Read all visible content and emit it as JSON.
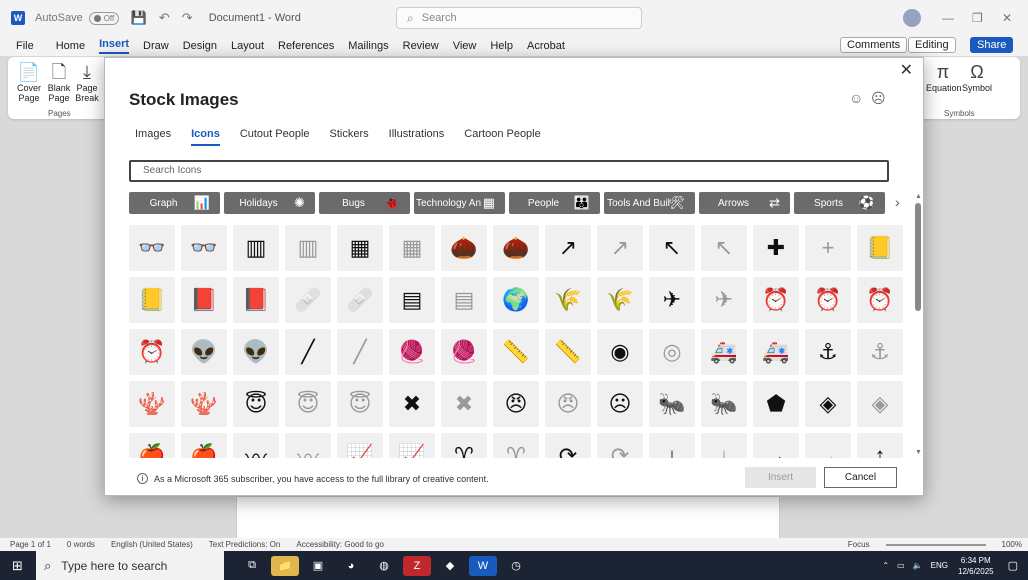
{
  "app": {
    "logo": "W",
    "autosave_label": "AutoSave",
    "autosave_state": "Off",
    "document_title": "Document1 - Word",
    "search_placeholder": "Search",
    "window_controls": [
      "—",
      "❐",
      "✕"
    ]
  },
  "menu": [
    "File",
    "Home",
    "Insert",
    "Draw",
    "Design",
    "Layout",
    "References",
    "Mailings",
    "Review",
    "View",
    "Help",
    "Acrobat"
  ],
  "menu_active": "Insert",
  "right_buttons": {
    "comments": "Comments",
    "editing": "Editing",
    "share": "Share"
  },
  "ribbon": {
    "items": [
      {
        "label": "Cover Page",
        "icon": "📄"
      },
      {
        "label": "Blank Page",
        "icon": "🗋"
      },
      {
        "label": "Page Break",
        "icon": "⤓"
      },
      {
        "label": "Equation",
        "icon": "π"
      },
      {
        "label": "Symbol",
        "icon": "Ω"
      }
    ],
    "groups": {
      "pages": "Pages",
      "symbols": "Symbols"
    }
  },
  "dialog": {
    "title": "Stock Images",
    "close": "✕",
    "tabs": [
      "Images",
      "Icons",
      "Cutout People",
      "Stickers",
      "Illustrations",
      "Cartoon People"
    ],
    "active_tab": "Icons",
    "search_placeholder": "Search Icons",
    "categories": [
      {
        "label": "Graph",
        "icon": "📊"
      },
      {
        "label": "Holidays",
        "icon": "✺"
      },
      {
        "label": "Bugs",
        "icon": "🐞"
      },
      {
        "label": "Technology An",
        "icon": "▦"
      },
      {
        "label": "People",
        "icon": "👪"
      },
      {
        "label": "Tools And Buil",
        "icon": "🛠"
      },
      {
        "label": "Arrows",
        "icon": "⇄"
      },
      {
        "label": "Sports",
        "icon": "⚽"
      }
    ],
    "next_arrow": "›",
    "icons": [
      {
        "name": "glasses-3d-icon",
        "glyph": "👓",
        "outline": false
      },
      {
        "name": "glasses-3d-outline-icon",
        "glyph": "👓",
        "outline": true
      },
      {
        "name": "abacus-icon",
        "glyph": "▥",
        "outline": false
      },
      {
        "name": "abacus-outline-icon",
        "glyph": "▥",
        "outline": true
      },
      {
        "name": "abacus-wide-icon",
        "glyph": "▦",
        "outline": false
      },
      {
        "name": "abacus-wide-outline-icon",
        "glyph": "▦",
        "outline": true
      },
      {
        "name": "acorn-icon",
        "glyph": "🌰",
        "outline": false
      },
      {
        "name": "acorn-outline-icon",
        "glyph": "🌰",
        "outline": true
      },
      {
        "name": "arrow-curve-right-icon",
        "glyph": "↗",
        "outline": false
      },
      {
        "name": "arrow-curve-right-outline-icon",
        "glyph": "↗",
        "outline": true
      },
      {
        "name": "arrow-curve-left-icon",
        "glyph": "↖",
        "outline": false
      },
      {
        "name": "arrow-curve-left-outline-icon",
        "glyph": "↖",
        "outline": true
      },
      {
        "name": "plus-icon",
        "glyph": "✚",
        "outline": false
      },
      {
        "name": "plus-outline-icon",
        "glyph": "+",
        "outline": true
      },
      {
        "name": "address-book-icon",
        "glyph": "📒",
        "outline": false
      },
      {
        "name": "address-book-outline-icon",
        "glyph": "📒",
        "outline": true
      },
      {
        "name": "address-book-2-icon",
        "glyph": "📕",
        "outline": false
      },
      {
        "name": "address-book-2-outline-icon",
        "glyph": "📕",
        "outline": true
      },
      {
        "name": "bandage-icon",
        "glyph": "🩹",
        "outline": false
      },
      {
        "name": "bandage-outline-icon",
        "glyph": "🩹",
        "outline": true
      },
      {
        "name": "billboard-icon",
        "glyph": "▤",
        "outline": false
      },
      {
        "name": "billboard-outline-icon",
        "glyph": "▤",
        "outline": true
      },
      {
        "name": "africa-icon",
        "glyph": "🌍",
        "outline": false
      },
      {
        "name": "farm-field-icon",
        "glyph": "🌾",
        "outline": false
      },
      {
        "name": "farm-field-outline-icon",
        "glyph": "🌾",
        "outline": true
      },
      {
        "name": "airplane-icon",
        "glyph": "✈",
        "outline": false
      },
      {
        "name": "airplane-outline-icon",
        "glyph": "✈",
        "outline": true
      },
      {
        "name": "alarm-clock-icon",
        "glyph": "⏰",
        "outline": false
      },
      {
        "name": "alarm-clock-outline-icon",
        "glyph": "⏰",
        "outline": true
      },
      {
        "name": "alarm-ringing-icon",
        "glyph": "⏰",
        "outline": false
      },
      {
        "name": "alarm-ringing-outline-icon",
        "glyph": "⏰",
        "outline": true
      },
      {
        "name": "alien-icon",
        "glyph": "👽",
        "outline": false
      },
      {
        "name": "alien-outline-icon",
        "glyph": "👽",
        "outline": true
      },
      {
        "name": "knitting-needle-icon",
        "glyph": "╱",
        "outline": false
      },
      {
        "name": "knitting-needle-outline-icon",
        "glyph": "╱",
        "outline": true
      },
      {
        "name": "yarn-icon",
        "glyph": "🧶",
        "outline": false
      },
      {
        "name": "yarn-outline-icon",
        "glyph": "🧶",
        "outline": true
      },
      {
        "name": "tape-measure-icon",
        "glyph": "📏",
        "outline": false
      },
      {
        "name": "tape-measure-outline-icon",
        "glyph": "📏",
        "outline": true
      },
      {
        "name": "button-icon",
        "glyph": "◉",
        "outline": false
      },
      {
        "name": "button-outline-icon",
        "glyph": "◎",
        "outline": true
      },
      {
        "name": "ambulance-icon",
        "glyph": "🚑",
        "outline": false
      },
      {
        "name": "ambulance-outline-icon",
        "glyph": "🚑",
        "outline": true
      },
      {
        "name": "anchor-icon",
        "glyph": "⚓",
        "outline": false
      },
      {
        "name": "anchor-outline-icon",
        "glyph": "⚓",
        "outline": true
      },
      {
        "name": "coral-icon",
        "glyph": "🪸",
        "outline": false
      },
      {
        "name": "coral-outline-icon",
        "glyph": "🪸",
        "outline": true
      },
      {
        "name": "angel-face-icon",
        "glyph": "😇",
        "outline": false
      },
      {
        "name": "angel-face-outline-icon",
        "glyph": "😇",
        "outline": true
      },
      {
        "name": "angel-face-2-icon",
        "glyph": "😇",
        "outline": true
      },
      {
        "name": "anger-symbol-icon",
        "glyph": "✖",
        "outline": false
      },
      {
        "name": "anger-symbol-outline-icon",
        "glyph": "✖",
        "outline": true
      },
      {
        "name": "angry-face-icon",
        "glyph": "😠",
        "outline": false
      },
      {
        "name": "angry-face-outline-icon",
        "glyph": "😠",
        "outline": true
      },
      {
        "name": "angry-face-2-icon",
        "glyph": "☹",
        "outline": false
      },
      {
        "name": "ant-icon",
        "glyph": "🐜",
        "outline": false
      },
      {
        "name": "ant-outline-icon",
        "glyph": "🐜",
        "outline": true
      },
      {
        "name": "antarctica-icon",
        "glyph": "⬟",
        "outline": false
      },
      {
        "name": "aperture-icon",
        "glyph": "◈",
        "outline": false
      },
      {
        "name": "aperture-outline-icon",
        "glyph": "◈",
        "outline": true
      },
      {
        "name": "apple-icon",
        "glyph": "🍎",
        "outline": false
      },
      {
        "name": "apple-outline-icon",
        "glyph": "🍎",
        "outline": true
      },
      {
        "name": "wave-icon",
        "glyph": "〰",
        "outline": false
      },
      {
        "name": "wave-outline-icon",
        "glyph": "〰",
        "outline": true
      },
      {
        "name": "chart-icon",
        "glyph": "📈",
        "outline": false
      },
      {
        "name": "chart-outline-icon",
        "glyph": "📈",
        "outline": true
      },
      {
        "name": "aries-icon",
        "glyph": "♈",
        "outline": false
      },
      {
        "name": "aries-outline-icon",
        "glyph": "♈",
        "outline": true
      },
      {
        "name": "arrow-circle-icon",
        "glyph": "⟳",
        "outline": false
      },
      {
        "name": "arrow-circle-outline-icon",
        "glyph": "⟳",
        "outline": true
      },
      {
        "name": "arrow-down-icon",
        "glyph": "↓",
        "outline": false
      },
      {
        "name": "arrow-down-outline-icon",
        "glyph": "↓",
        "outline": true
      },
      {
        "name": "arrow-right-icon",
        "glyph": "→",
        "outline": false
      },
      {
        "name": "arrow-right-outline-icon",
        "glyph": "→",
        "outline": true
      },
      {
        "name": "arrow-up-icon",
        "glyph": "↑",
        "outline": false
      }
    ],
    "footer_text": "As a Microsoft 365 subscriber, you have access to the full library of creative content.",
    "footer_icon": "i",
    "insert": "Insert",
    "cancel": "Cancel"
  },
  "status": {
    "page": "Page 1 of 1",
    "words": "0 words",
    "language": "English (United States)",
    "predictions": "Text Predictions: On",
    "accessibility": "Accessibility: Good to go",
    "focus": "Focus",
    "zoom": "100%"
  },
  "taskbar": {
    "search": "Type here to search",
    "lang": "ENG",
    "time": "6:34 PM",
    "date": "12/6/2025"
  }
}
